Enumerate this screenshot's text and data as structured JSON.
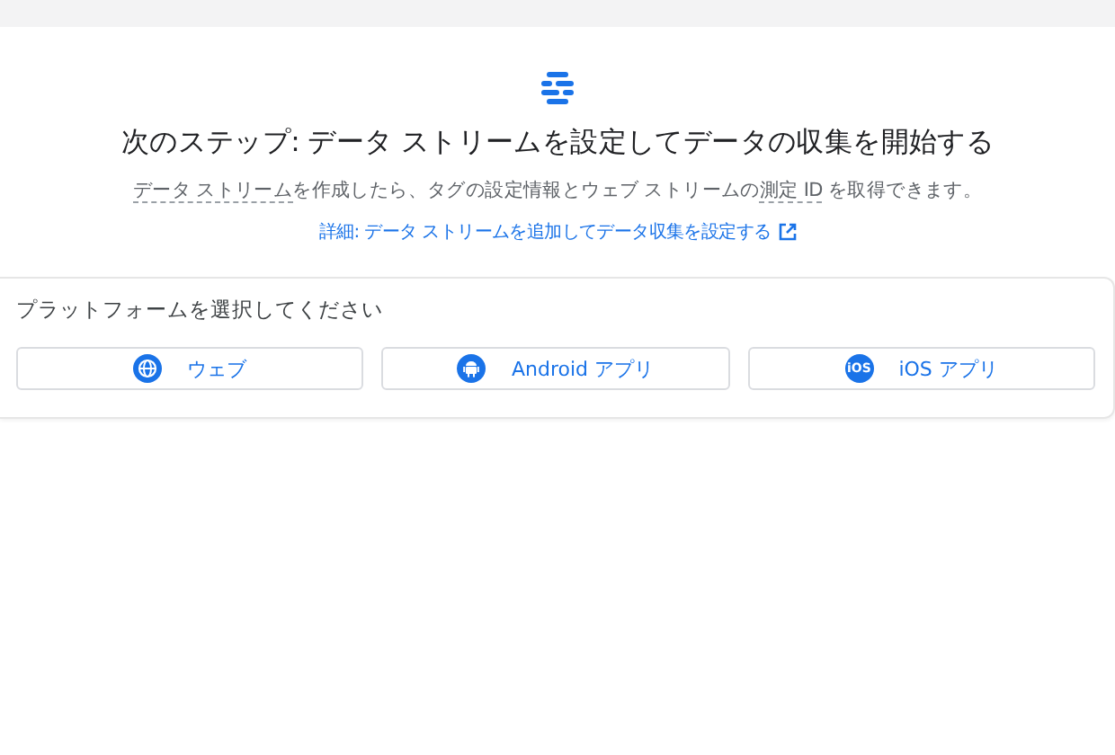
{
  "heading": {
    "title": "次のステップ: データ ストリームを設定してデータの収集を開始する",
    "description": [
      {
        "kind": "term",
        "text": "データ ストリーム"
      },
      {
        "kind": "plain",
        "text": "を作成したら、タグの設定情報とウェブ ストリームの"
      },
      {
        "kind": "term",
        "text": "測定 ID"
      },
      {
        "kind": "plain",
        "text": " を取得できます。"
      }
    ],
    "link": "詳細: データ ストリームを追加してデータ収集を設定する"
  },
  "platform_card": {
    "label": "プラットフォームを選択してください",
    "platforms": [
      {
        "kind": "web",
        "label": "ウェブ"
      },
      {
        "kind": "android",
        "label": "Android アプリ"
      },
      {
        "kind": "ios",
        "label": "iOS アプリ",
        "icon_text": "iOS"
      }
    ]
  }
}
